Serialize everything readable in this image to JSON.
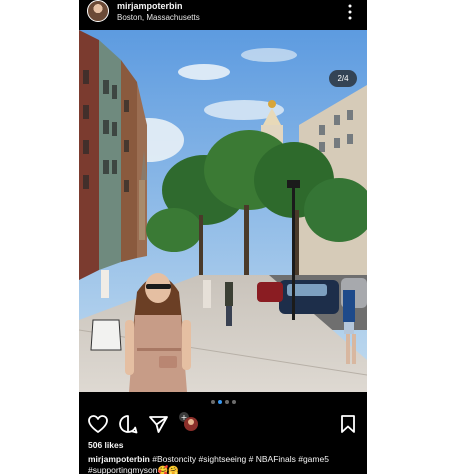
{
  "post": {
    "username": "mirjampoterbin",
    "location": "Boston, Massachusetts",
    "counter": "2/4",
    "likes": "506 likes",
    "caption_user": "mirjampoterbin",
    "caption_text": " #Bostoncity #sightseeing # NBAFinals #game5 #supportingmyson",
    "caption_emoji": "🥰🤗"
  },
  "carousel": {
    "total": 4,
    "current": 2
  },
  "icons": {
    "avatar": "profile-avatar",
    "more": "more-vertical-icon",
    "like": "heart-icon",
    "comment": "comment-icon",
    "share": "send-icon",
    "save": "bookmark-icon"
  },
  "colors": {
    "background": "#000000",
    "text": "#f5f5f5",
    "active_dot": "#3897f0"
  }
}
